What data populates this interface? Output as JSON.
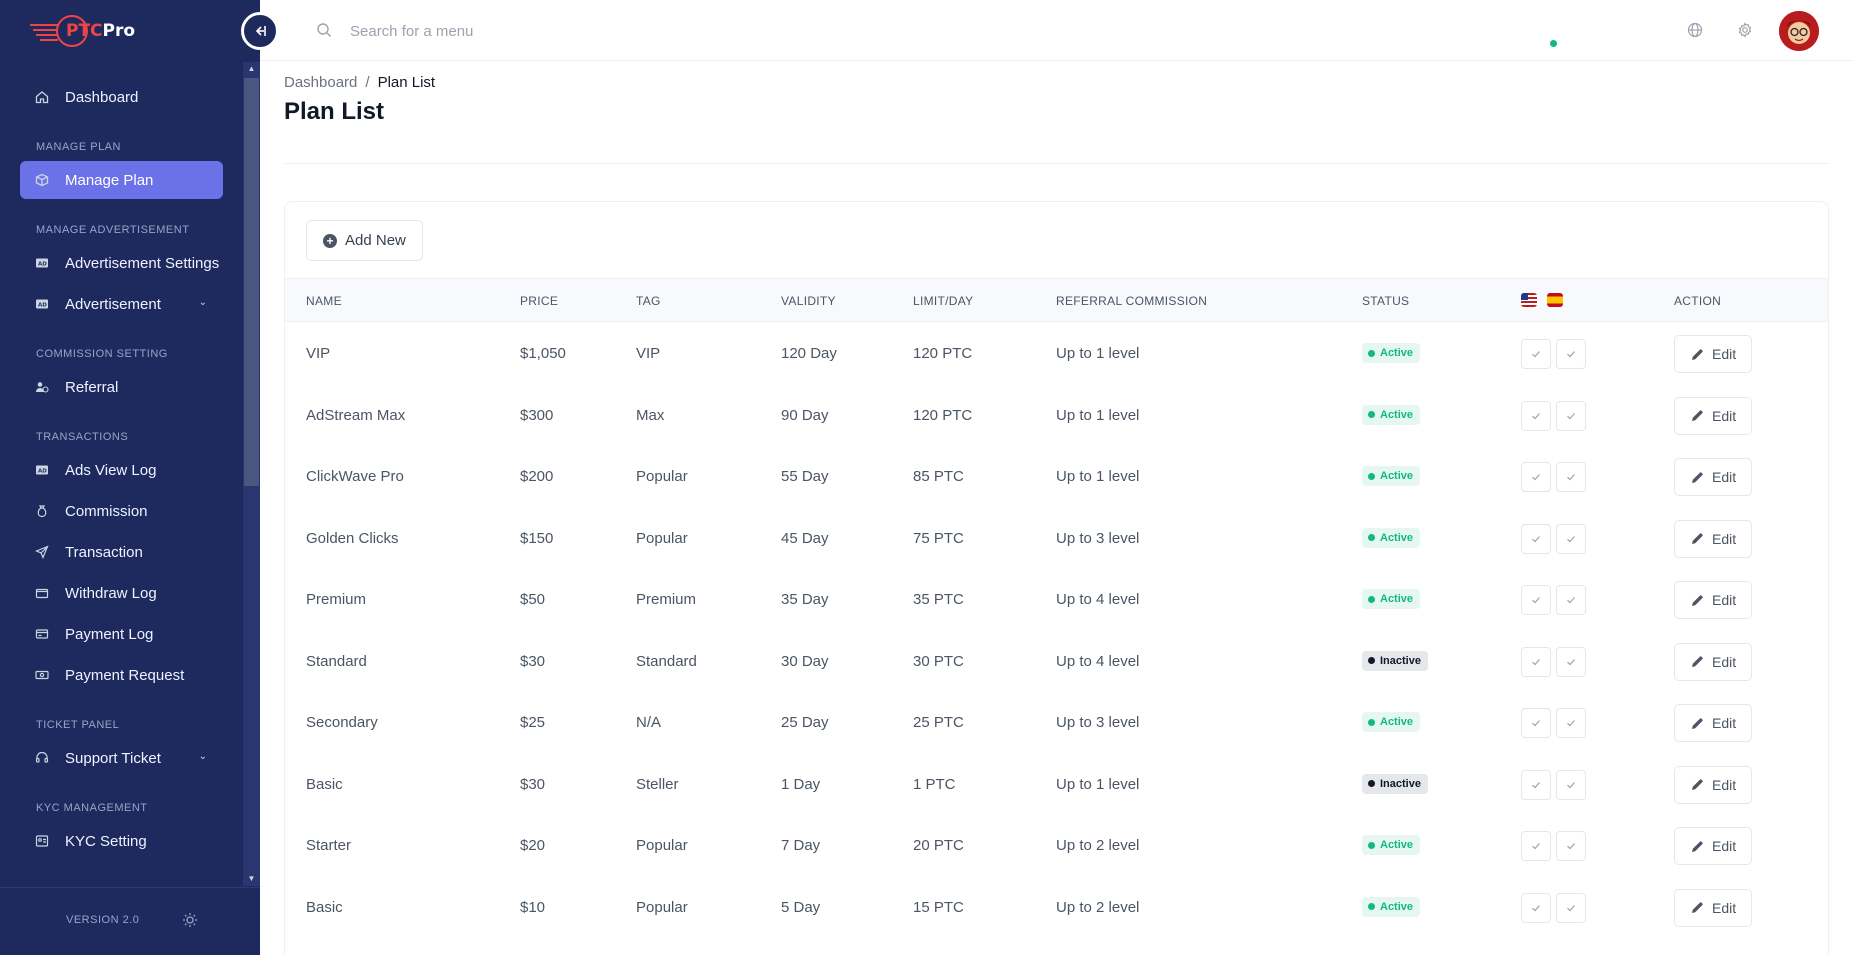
{
  "brand": {
    "logo_accent": "PTC",
    "logo_rest": "Pro"
  },
  "sidebar": {
    "items": [
      {
        "type": "item",
        "label": "Dashboard",
        "icon": "home-icon"
      },
      {
        "type": "section",
        "label": "MANAGE PLAN"
      },
      {
        "type": "item",
        "label": "Manage Plan",
        "icon": "cube-icon",
        "active": true
      },
      {
        "type": "section",
        "label": "MANAGE ADVERTISEMENT"
      },
      {
        "type": "item",
        "label": "Advertisement Settings",
        "icon": "ad-icon"
      },
      {
        "type": "item",
        "label": "Advertisement",
        "icon": "ad-icon",
        "chevron": true
      },
      {
        "type": "section",
        "label": "COMMISSION SETTING"
      },
      {
        "type": "item",
        "label": "Referral",
        "icon": "users-icon"
      },
      {
        "type": "section",
        "label": "TRANSACTIONS"
      },
      {
        "type": "item",
        "label": "Ads View Log",
        "icon": "ad-icon"
      },
      {
        "type": "item",
        "label": "Commission",
        "icon": "money-bag-icon"
      },
      {
        "type": "item",
        "label": "Transaction",
        "icon": "send-icon"
      },
      {
        "type": "item",
        "label": "Withdraw Log",
        "icon": "wallet-icon"
      },
      {
        "type": "item",
        "label": "Payment Log",
        "icon": "card-icon"
      },
      {
        "type": "item",
        "label": "Payment Request",
        "icon": "cash-icon"
      },
      {
        "type": "section",
        "label": "TICKET PANEL"
      },
      {
        "type": "item",
        "label": "Support Ticket",
        "icon": "headset-icon",
        "chevron": true
      },
      {
        "type": "section",
        "label": "KYC MANAGEMENT"
      },
      {
        "type": "item",
        "label": "KYC Setting",
        "icon": "id-icon"
      }
    ],
    "version": "VERSION 2.0"
  },
  "search": {
    "placeholder": "Search for a menu"
  },
  "breadcrumb": {
    "home": "Dashboard",
    "separator": "/",
    "current": "Plan List"
  },
  "page_title": "Plan List",
  "add_new_label": "Add New",
  "table": {
    "headers": {
      "name": "NAME",
      "price": "PRICE",
      "tag": "TAG",
      "validity": "VALIDITY",
      "limit": "LIMIT/DAY",
      "referral": "REFERRAL COMMISSION",
      "status": "STATUS",
      "action": "ACTION"
    },
    "language_flags": [
      "us-flag-icon",
      "es-flag-icon"
    ],
    "edit_label": "Edit",
    "rows": [
      {
        "name": "VIP",
        "price": "$1,050",
        "tag": "VIP",
        "validity": "120 Day",
        "limit": "120 PTC",
        "referral": "Up to 1 level",
        "status": "Active"
      },
      {
        "name": "AdStream Max",
        "price": "$300",
        "tag": "Max",
        "validity": "90 Day",
        "limit": "120 PTC",
        "referral": "Up to 1 level",
        "status": "Active"
      },
      {
        "name": "ClickWave Pro",
        "price": "$200",
        "tag": "Popular",
        "validity": "55 Day",
        "limit": "85 PTC",
        "referral": "Up to 1 level",
        "status": "Active"
      },
      {
        "name": "Golden Clicks",
        "price": "$150",
        "tag": "Popular",
        "validity": "45 Day",
        "limit": "75 PTC",
        "referral": "Up to 3 level",
        "status": "Active"
      },
      {
        "name": "Premium",
        "price": "$50",
        "tag": "Premium",
        "validity": "35 Day",
        "limit": "35 PTC",
        "referral": "Up to 4 level",
        "status": "Active"
      },
      {
        "name": "Standard",
        "price": "$30",
        "tag": "Standard",
        "validity": "30 Day",
        "limit": "30 PTC",
        "referral": "Up to 4 level",
        "status": "Inactive"
      },
      {
        "name": "Secondary",
        "price": "$25",
        "tag": "N/A",
        "validity": "25 Day",
        "limit": "25 PTC",
        "referral": "Up to 3 level",
        "status": "Active"
      },
      {
        "name": "Basic",
        "price": "$30",
        "tag": "Steller",
        "validity": "1 Day",
        "limit": "1 PTC",
        "referral": "Up to 1 level",
        "status": "Inactive"
      },
      {
        "name": "Starter",
        "price": "$20",
        "tag": "Popular",
        "validity": "7 Day",
        "limit": "20 PTC",
        "referral": "Up to 2 level",
        "status": "Active"
      },
      {
        "name": "Basic",
        "price": "$10",
        "tag": "Popular",
        "validity": "5 Day",
        "limit": "15 PTC",
        "referral": "Up to 2 level",
        "status": "Active"
      }
    ]
  },
  "colors": {
    "sidebar_bg": "#1e2a5e",
    "active_item": "#6b72e8",
    "status_active": "#10b981",
    "status_inactive": "#111827",
    "logo_red": "#ef4444"
  }
}
